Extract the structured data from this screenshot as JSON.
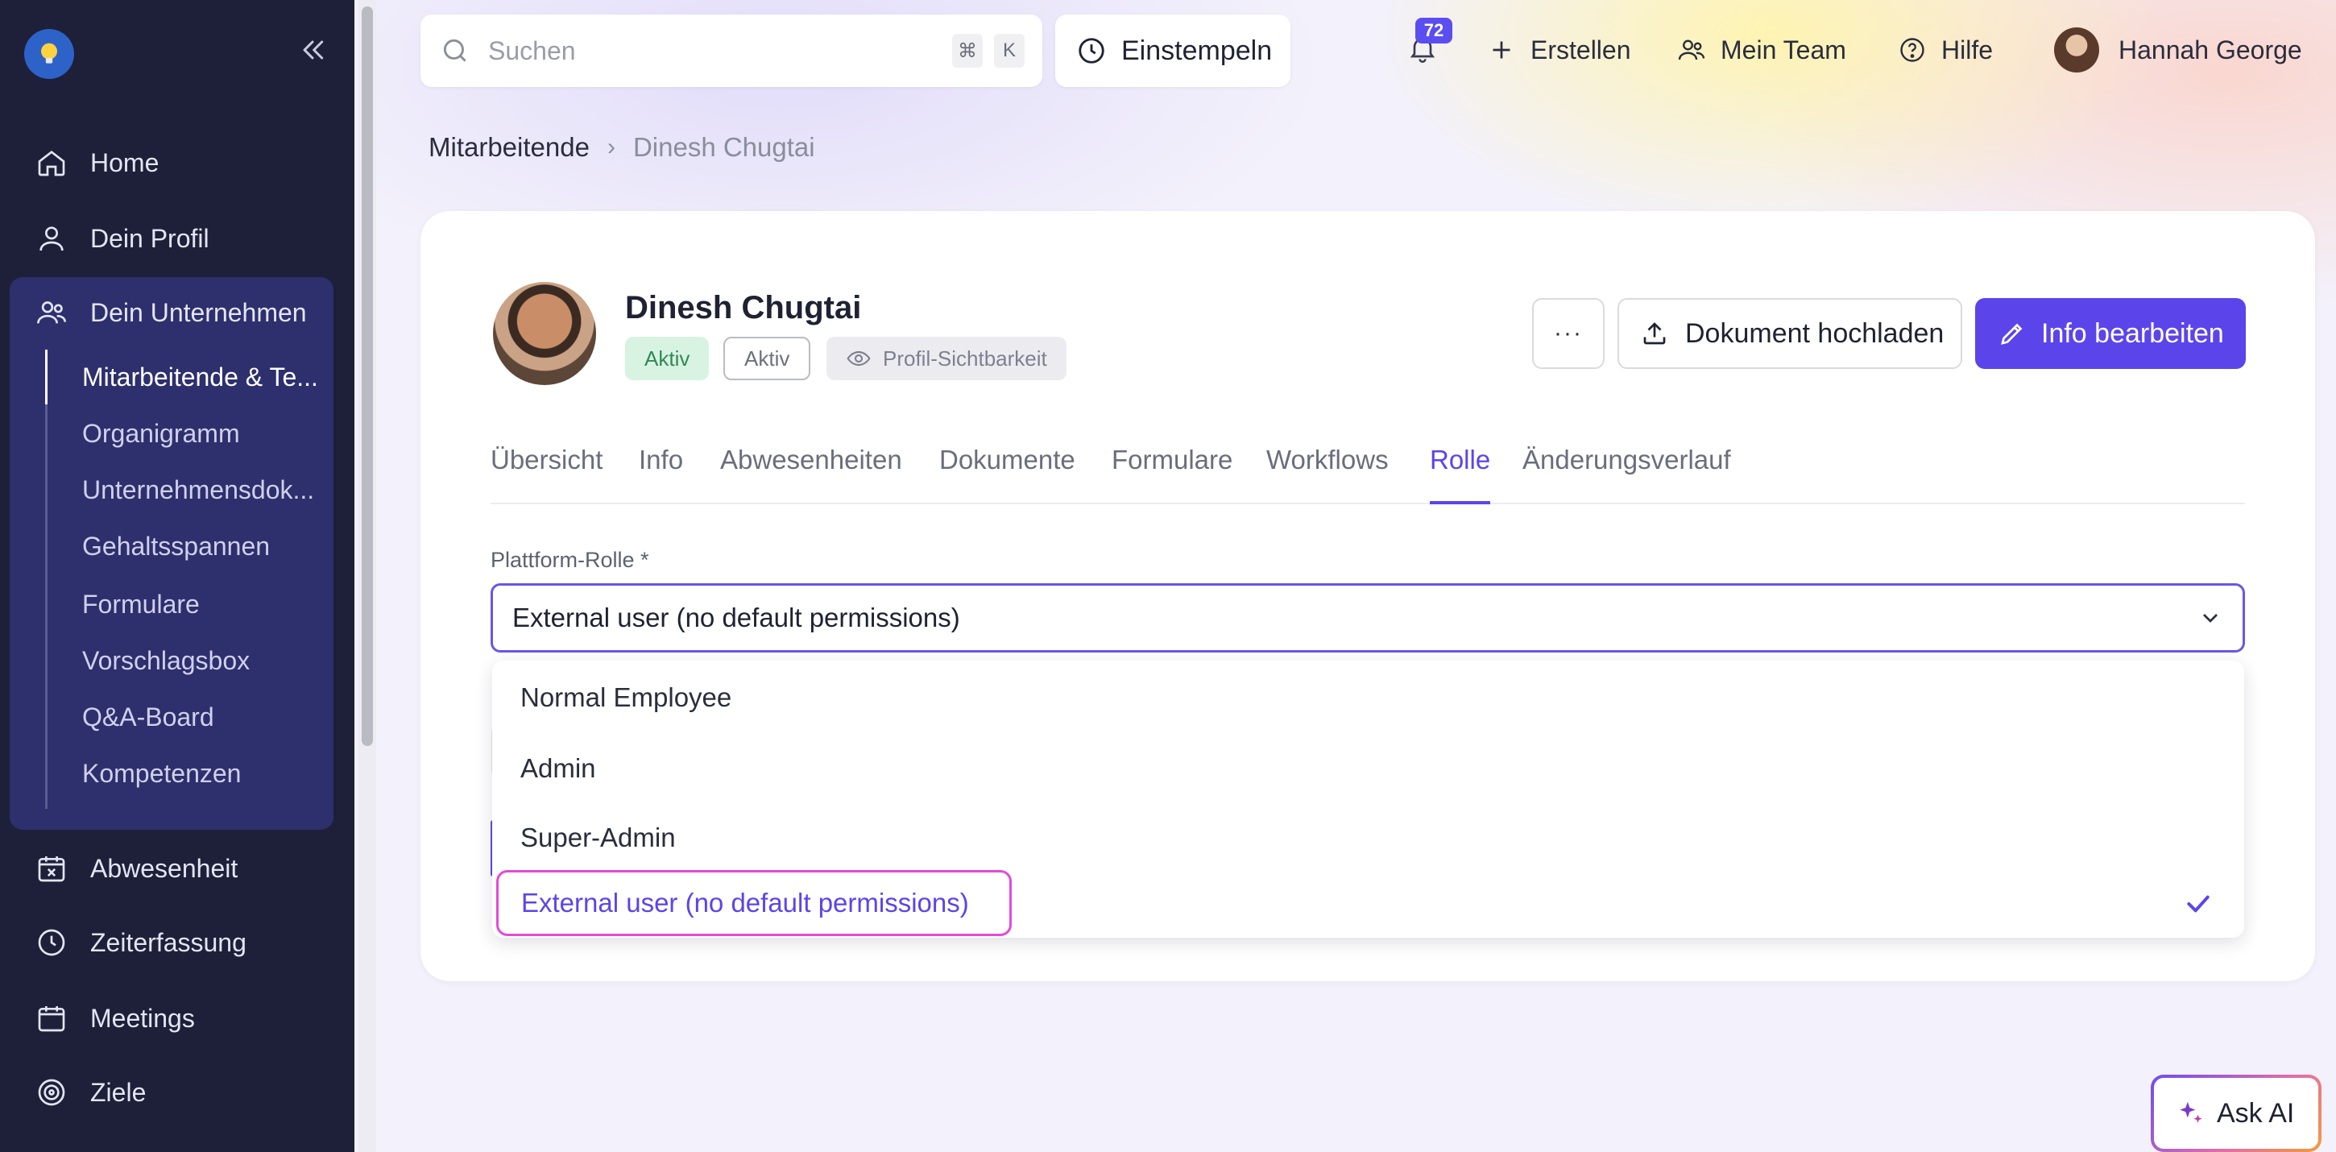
{
  "sidebar": {
    "items": [
      {
        "label": "Home",
        "icon": "home-icon"
      },
      {
        "label": "Dein Profil",
        "icon": "user-icon"
      },
      {
        "label": "Dein Unternehmen",
        "icon": "users-icon"
      },
      {
        "label": "Abwesenheit",
        "icon": "calendar-x-icon"
      },
      {
        "label": "Zeiterfassung",
        "icon": "clock-icon"
      },
      {
        "label": "Meetings",
        "icon": "calendar-icon"
      },
      {
        "label": "Ziele",
        "icon": "target-icon"
      }
    ],
    "company_sub": [
      "Mitarbeitende & Te...",
      "Organigramm",
      "Unternehmensdok...",
      "Gehaltsspannen",
      "Formulare",
      "Vorschlagsbox",
      "Q&A-Board",
      "Kompetenzen"
    ]
  },
  "topbar": {
    "search_placeholder": "Suchen",
    "shortcut_cmd": "⌘",
    "shortcut_key": "K",
    "clock_in": "Einstempeln",
    "notification_count": "72",
    "create": "Erstellen",
    "my_team": "Mein Team",
    "help": "Hilfe",
    "user_name": "Hannah George"
  },
  "breadcrumb": {
    "parent": "Mitarbeitende",
    "current": "Dinesh Chugtai"
  },
  "employee": {
    "name": "Dinesh Chugtai",
    "status_1": "Aktiv",
    "status_2": "Aktiv",
    "visibility": "Profil-Sichtbarkeit",
    "more": "···",
    "upload": "Dokument hochladen",
    "edit": "Info bearbeiten"
  },
  "tabs": [
    "Übersicht",
    "Info",
    "Abwesenheiten",
    "Dokumente",
    "Formulare",
    "Workflows",
    "Rolle",
    "Änderungsverlauf"
  ],
  "role_form": {
    "label": "Plattform-Rolle *",
    "selected": "External user (no default permissions)",
    "options": [
      "Normal Employee",
      "Admin",
      "Super-Admin",
      "External user (no default permissions)"
    ]
  },
  "ask_ai": "Ask AI",
  "colors": {
    "accent": "#5b45ea",
    "sidebar": "#1d2038",
    "sidebar_active": "#2e2f6d",
    "status_green": "#2f8a54",
    "highlight": "#e34ad8"
  }
}
